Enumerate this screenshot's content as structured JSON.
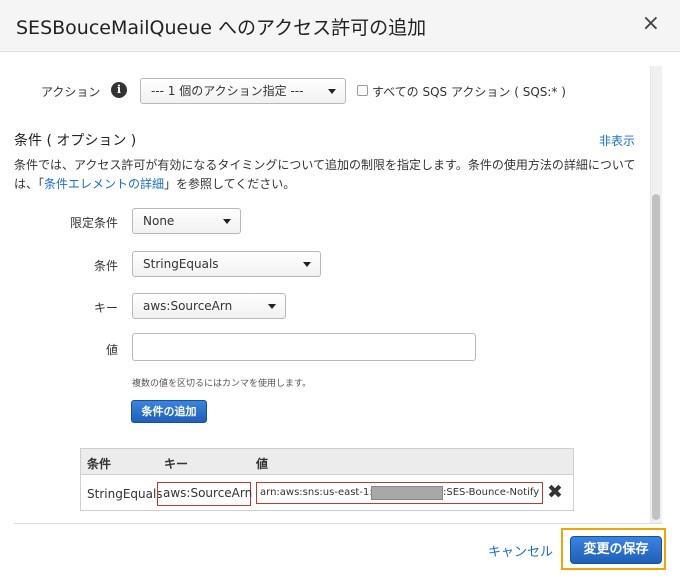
{
  "dialog": {
    "title": "SESBouceMailQueue へのアクセス許可の追加",
    "close_icon": "×"
  },
  "action": {
    "label": "アクション",
    "info_icon": "i",
    "select_value": "--- 1 個のアクション指定 ---",
    "all_sqs_label": "すべての SQS アクション ( SQS:* )"
  },
  "conditions": {
    "title": "条件 ( オプション )",
    "hide_link": "非表示",
    "desc_part1": "条件では、アクセス許可が有効になるタイミングについて追加の制限を指定します。条件の使用方法の詳細については、「",
    "desc_link": "条件エレメントの詳細",
    "desc_part2": "」を参照してください。",
    "qualifier_label": "限定条件",
    "qualifier_value": "None",
    "condition_label": "条件",
    "condition_value": "StringEquals",
    "key_label": "キー",
    "key_value": "aws:SourceArn",
    "value_label": "値",
    "value_input": "",
    "hint": "複数の値を区切るにはカンマを使用します。",
    "add_button": "条件の追加"
  },
  "table": {
    "headers": [
      "条件",
      "キー",
      "値"
    ],
    "rows": [
      {
        "condition": "StringEquals",
        "key": "aws:SourceArn",
        "value_prefix": "arn:aws:sns:us-east-1:",
        "value_suffix": ":SES-Bounce-Notify"
      }
    ],
    "remove_icon": "✖"
  },
  "footer": {
    "cancel": "キャンセル",
    "save": "変更の保存"
  },
  "colors": {
    "accent_blue": "#1f5fb8",
    "link_blue": "#1a6ec8",
    "highlight_red": "#c0392b",
    "highlight_orange": "#f0a500"
  }
}
